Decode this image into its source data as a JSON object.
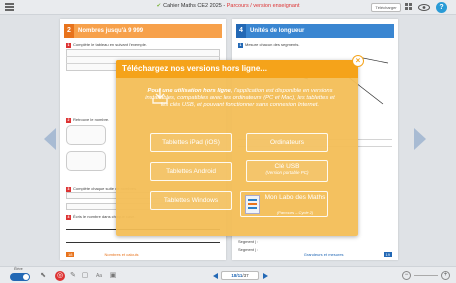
{
  "header": {
    "app_title": "Cahier Maths CE2 2025",
    "separator": " - ",
    "edition": "Parcours / version enseignant",
    "download_label": "Télécharger"
  },
  "left_page": {
    "chapter_number": "2",
    "chapter_title": "Nombres jusqu'à 9 999",
    "exercise_1": "Complète le tableau en suivant l'exemple.",
    "exercise_2": "Retrouve le nombre.",
    "exercise_3": "Complète chaque suite de nombres.",
    "exercise_4": "Écris le nombre dans chaque case.",
    "footer": "Nombres et calculs",
    "page_number": "18"
  },
  "right_page": {
    "chapter_number": "4",
    "chapter_title": "Unités de longueur",
    "exercise_1": "Mesure chacun des segments.",
    "segment_a": "Segment | :",
    "segment_b": "Segment | :",
    "footer": "Grandeurs et mesures",
    "page_number": "19"
  },
  "modal": {
    "title": "Téléchargez nos versions hors ligne...",
    "text_bold": "Pour une utilisation hors ligne",
    "text_rest": ", l'application est disponible en versions installables, compatibles avec les ordinateurs (PC et Mac), les tablettes et les clés USB, et pouvant fonctionner sans connexion Internet.",
    "buttons": {
      "ipad": "Tablettes iPad (iOS)",
      "computers": "Ordinateurs",
      "android": "Tablettes Android",
      "usb_title": "Clé USB",
      "usb_sub": "(Version portable PC)",
      "windows": "Tablettes Windows",
      "monlabo_title": "Mon Labo des Maths",
      "monlabo_sub": "(Parcours – Cycle 2)"
    },
    "close_label": "×"
  },
  "bottombar": {
    "mode_label": "Élève",
    "page_current": "18/11",
    "page_total": "/37"
  },
  "colors": {
    "accent_orange": "#f5a31a",
    "chapter_blue": "#2268b5",
    "chapter_orange": "#e8731c",
    "modal_bg": "#f3be56"
  }
}
